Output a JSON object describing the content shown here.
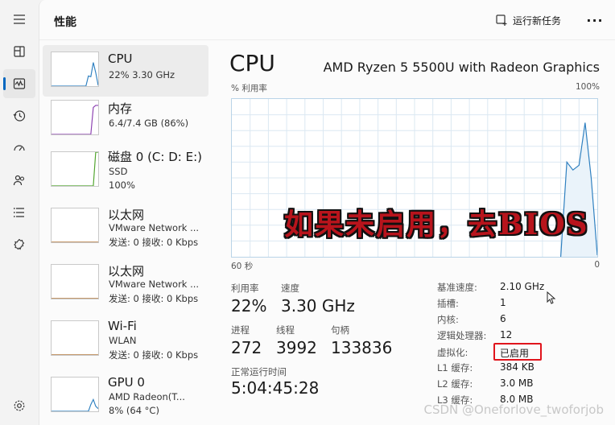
{
  "window": {
    "title": "性能"
  },
  "toolbar": {
    "run_new_task": "运行新任务",
    "more": "···"
  },
  "rail": [
    {
      "name": "hamburger-icon"
    },
    {
      "name": "processes-icon"
    },
    {
      "name": "performance-icon",
      "active": true
    },
    {
      "name": "app-history-icon"
    },
    {
      "name": "startup-apps-icon"
    },
    {
      "name": "users-icon"
    },
    {
      "name": "details-icon"
    },
    {
      "name": "services-icon"
    },
    {
      "name": "settings-icon"
    }
  ],
  "devices": [
    {
      "name": "CPU",
      "lines": [
        "22%  3.30 GHz"
      ],
      "color": "#2f80c0",
      "selected": true
    },
    {
      "name": "内存",
      "lines": [
        "6.4/7.4 GB (86%)"
      ],
      "color": "#8b3fb0"
    },
    {
      "name": "磁盘 0 (C: D: E:)",
      "lines": [
        "SSD",
        "100%"
      ],
      "color": "#4ea32a"
    },
    {
      "name": "以太网",
      "lines": [
        "VMware Network ...",
        "发送: 0  接收: 0 Kbps"
      ],
      "color": "#a45e16"
    },
    {
      "name": "以太网",
      "lines": [
        "VMware Network ...",
        "发送: 0  接收: 0 Kbps"
      ],
      "color": "#a45e16"
    },
    {
      "name": "Wi-Fi",
      "lines": [
        "WLAN",
        "发送: 0  接收: 0 Kbps"
      ],
      "color": "#a45e16"
    },
    {
      "name": "GPU 0",
      "lines": [
        "AMD Radeon(T...",
        "8% (64 °C)"
      ],
      "color": "#2f80c0"
    }
  ],
  "detail": {
    "title": "CPU",
    "model": "AMD Ryzen 5 5500U with Radeon Graphics",
    "graph_label": "% 利用率",
    "graph_max": "100%",
    "graph_span": "60 秒",
    "graph_min": "0",
    "overlay_text": "如果未启用，去BIOS",
    "utilization_points": [
      0,
      0,
      0,
      0,
      0,
      0,
      0,
      0,
      0,
      0,
      0,
      0,
      0,
      0,
      0,
      0,
      0,
      0,
      0,
      0,
      0,
      0,
      0,
      0,
      0,
      0,
      0,
      0,
      0,
      0,
      0,
      0,
      0,
      0,
      0,
      0,
      0,
      0,
      0,
      0,
      0,
      0,
      0,
      0,
      0,
      0,
      0,
      0,
      0,
      0,
      0,
      0,
      0,
      0,
      0,
      60,
      55,
      58,
      85,
      50,
      1
    ],
    "stats": {
      "utilization_label": "利用率",
      "utilization": "22%",
      "speed_label": "速度",
      "speed": "3.30 GHz",
      "processes_label": "进程",
      "processes": "272",
      "threads_label": "线程",
      "threads": "3992",
      "handles_label": "句柄",
      "handles": "133836",
      "uptime_label": "正常运行时间",
      "uptime": "5:04:45:28"
    },
    "specs": [
      {
        "label": "基准速度:",
        "value": "2.10 GHz"
      },
      {
        "label": "插槽:",
        "value": "1"
      },
      {
        "label": "内核:",
        "value": "6"
      },
      {
        "label": "逻辑处理器:",
        "value": "12"
      },
      {
        "label": "虚拟化:",
        "value": "已启用"
      },
      {
        "label": "L1 缓存:",
        "value": "384 KB"
      },
      {
        "label": "L2 缓存:",
        "value": "3.0 MB"
      },
      {
        "label": "L3 缓存:",
        "value": "8.0 MB"
      }
    ]
  },
  "watermark": "CSDN @Oneforlove_twoforjob",
  "colors": {
    "accent": "#0067c0",
    "cpu_line": "#2f80c0",
    "highlight": "#e0141c",
    "overlay": "#b8141c"
  }
}
